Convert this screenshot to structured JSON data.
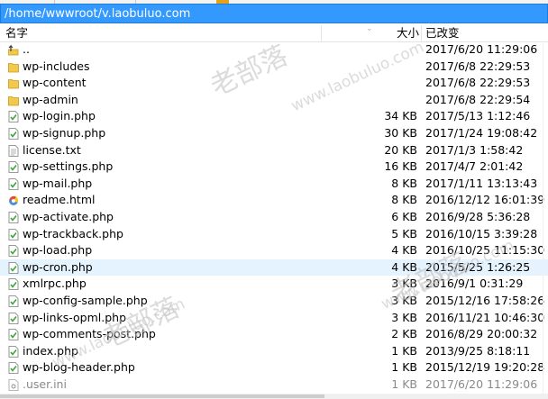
{
  "path": "/home/wwwroot/v.laobuluo.com",
  "columns": {
    "name": "名字",
    "size": "大小",
    "modified": "已改变"
  },
  "watermark": {
    "cn": "老部落",
    "url": "www.laobuluo.com"
  },
  "rows": [
    {
      "name": "..",
      "size": "",
      "modified": "2017/6/20 11:29:06",
      "icon": "parent-folder-icon"
    },
    {
      "name": "wp-includes",
      "size": "",
      "modified": "2017/6/8 22:29:53",
      "icon": "folder-icon"
    },
    {
      "name": "wp-content",
      "size": "",
      "modified": "2017/6/8 22:29:53",
      "icon": "folder-icon"
    },
    {
      "name": "wp-admin",
      "size": "",
      "modified": "2017/6/8 22:29:54",
      "icon": "folder-icon"
    },
    {
      "name": "wp-login.php",
      "size": "34 KB",
      "modified": "2017/5/13 1:12:46",
      "icon": "php-file-icon"
    },
    {
      "name": "wp-signup.php",
      "size": "30 KB",
      "modified": "2017/1/24 19:08:42",
      "icon": "php-file-icon"
    },
    {
      "name": "license.txt",
      "size": "20 KB",
      "modified": "2017/1/3 1:58:42",
      "icon": "text-file-icon"
    },
    {
      "name": "wp-settings.php",
      "size": "16 KB",
      "modified": "2017/4/7 2:01:42",
      "icon": "php-file-icon"
    },
    {
      "name": "wp-mail.php",
      "size": "8 KB",
      "modified": "2017/1/11 13:13:43",
      "icon": "php-file-icon"
    },
    {
      "name": "readme.html",
      "size": "8 KB",
      "modified": "2016/12/12 16:01:39",
      "icon": "html-file-icon"
    },
    {
      "name": "wp-activate.php",
      "size": "6 KB",
      "modified": "2016/9/28 5:36:28",
      "icon": "php-file-icon"
    },
    {
      "name": "wp-trackback.php",
      "size": "5 KB",
      "modified": "2016/10/15 3:39:28",
      "icon": "php-file-icon"
    },
    {
      "name": "wp-load.php",
      "size": "4 KB",
      "modified": "2016/10/25 11:15:30",
      "icon": "php-file-icon"
    },
    {
      "name": "wp-cron.php",
      "size": "4 KB",
      "modified": "2015/5/25 1:26:25",
      "icon": "php-file-icon"
    },
    {
      "name": "xmlrpc.php",
      "size": "3 KB",
      "modified": "2016/9/1 0:31:29",
      "icon": "php-file-icon"
    },
    {
      "name": "wp-config-sample.php",
      "size": "3 KB",
      "modified": "2015/12/16 17:58:26",
      "icon": "php-file-icon"
    },
    {
      "name": "wp-links-opml.php",
      "size": "3 KB",
      "modified": "2016/11/21 10:46:30",
      "icon": "php-file-icon"
    },
    {
      "name": "wp-comments-post.php",
      "size": "2 KB",
      "modified": "2016/8/29 20:00:32",
      "icon": "php-file-icon"
    },
    {
      "name": "index.php",
      "size": "1 KB",
      "modified": "2013/9/25 8:18:11",
      "icon": "php-file-icon"
    },
    {
      "name": "wp-blog-header.php",
      "size": "1 KB",
      "modified": "2015/12/19 19:20:28",
      "icon": "php-file-icon"
    },
    {
      "name": ".user.ini",
      "size": "1 KB",
      "modified": "2017/6/20 11:29:06",
      "icon": "ini-file-icon"
    }
  ],
  "colors": {
    "pathbar": "#3399ff",
    "highlight": "#e5f3ff",
    "folder": "#f2c94c",
    "php": "#3aa63a"
  }
}
